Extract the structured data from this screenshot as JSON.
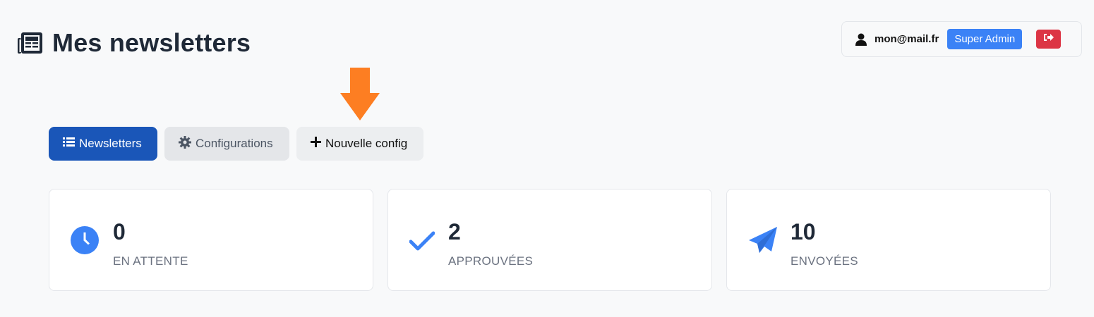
{
  "header": {
    "title": "Mes newsletters",
    "title_icon": "newspaper-icon"
  },
  "user": {
    "email": "mon@mail.fr",
    "role": "Super Admin",
    "user_icon": "user-icon",
    "logout_icon": "sign-out-icon"
  },
  "annotation": {
    "arrow_icon": "arrow-down-icon",
    "arrow_color": "#fd7e22"
  },
  "tabs": [
    {
      "label": "Newsletters",
      "icon": "list-icon",
      "active": true
    },
    {
      "label": "Configurations",
      "icon": "gear-icon",
      "active": false
    },
    {
      "label": "Nouvelle config",
      "icon": "plus-icon",
      "active": false
    }
  ],
  "stats": [
    {
      "value": "0",
      "label": "EN ATTENTE",
      "icon": "clock-icon"
    },
    {
      "value": "2",
      "label": "APPROUVÉES",
      "icon": "check-icon"
    },
    {
      "value": "10",
      "label": "ENVOYÉES",
      "icon": "paper-plane-icon"
    }
  ],
  "colors": {
    "primary": "#1a56b8",
    "accent_blue": "#3b82f6",
    "danger": "#dc3545",
    "background": "#f8f9fa"
  }
}
